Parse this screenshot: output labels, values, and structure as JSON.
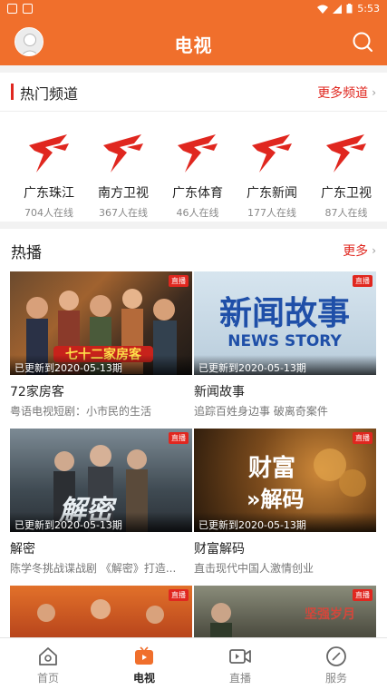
{
  "status_bar": {
    "time": "5:53"
  },
  "app_bar": {
    "title": "电视"
  },
  "hot_channels": {
    "title": "热门频道",
    "more": "更多频道",
    "channels": [
      {
        "name": "广东珠江",
        "online": "704人在线"
      },
      {
        "name": "南方卫视",
        "online": "367人在线"
      },
      {
        "name": "广东体育",
        "online": "46人在线"
      },
      {
        "name": "广东新闻",
        "online": "177人在线"
      },
      {
        "name": "广东卫视",
        "online": "87人在线"
      }
    ]
  },
  "hot_play": {
    "title": "热播",
    "more": "更多",
    "cards": [
      {
        "title": "72家房客",
        "desc": "粤语电视短剧：小市民的生活",
        "updated": "已更新到2020-05-13期",
        "badge": "直播"
      },
      {
        "title": "新闻故事",
        "desc": "追踪百姓身边事 破离奇案件",
        "updated": "已更新到2020-05-13期",
        "badge": "直播",
        "thumb_text": [
          "新闻故事",
          "NEWS STORY"
        ]
      },
      {
        "title": "解密",
        "desc": "陈学冬挑战谍战剧 《解密》打造...",
        "updated": "已更新到2020-05-13期",
        "badge": "直播",
        "thumb_text": [
          "解密"
        ]
      },
      {
        "title": "财富解码",
        "desc": "直击现代中国人激情创业",
        "updated": "已更新到2020-05-13期",
        "badge": "直播",
        "thumb_text": [
          "财富",
          "»解码"
        ]
      },
      {
        "title": "",
        "desc": "",
        "updated": "",
        "badge": "直播"
      },
      {
        "title": "",
        "desc": "",
        "updated": "",
        "badge": "直播",
        "thumb_text": [
          "坚强岁月"
        ]
      }
    ]
  },
  "tab_bar": {
    "tabs": [
      {
        "label": "首页",
        "icon": "home-icon",
        "active": false
      },
      {
        "label": "电视",
        "icon": "tv-icon",
        "active": true
      },
      {
        "label": "直播",
        "icon": "live-icon",
        "active": false
      },
      {
        "label": "服务",
        "icon": "compass-icon",
        "active": false
      }
    ]
  },
  "colors": {
    "accent": "#f06f2c",
    "red": "#e0271f",
    "background": "#f2f2f2"
  }
}
